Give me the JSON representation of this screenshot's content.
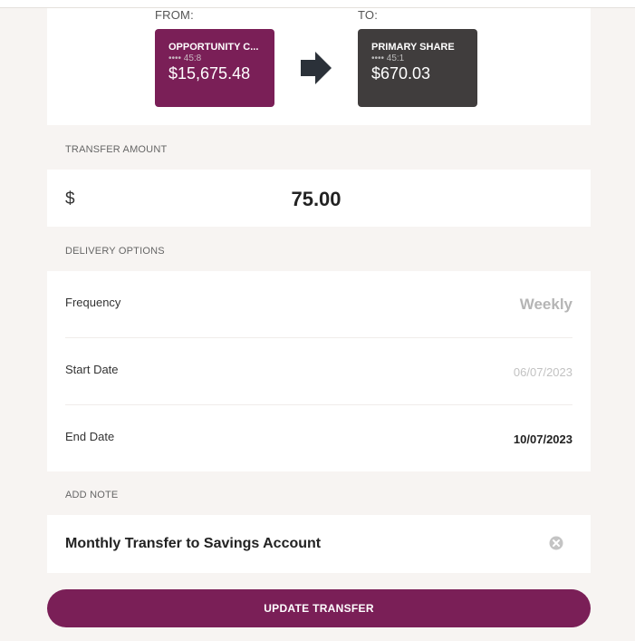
{
  "transfer": {
    "from_label": "FROM:",
    "to_label": "TO:",
    "from_account": {
      "name": "OPPORTUNITY C...",
      "mask": "•••• 45:8",
      "balance": "$15,675.48",
      "color": "#7a1f57"
    },
    "to_account": {
      "name": "PRIMARY SHARE",
      "mask": "•••• 45:1",
      "balance": "$670.03",
      "color": "#403d3d"
    },
    "arrow_icon": "arrow-right-icon"
  },
  "amount": {
    "header": "TRANSFER AMOUNT",
    "currency": "$",
    "value": "75.00"
  },
  "delivery": {
    "header": "DELIVERY OPTIONS",
    "frequency_label": "Frequency",
    "frequency_value": "Weekly",
    "start_label": "Start Date",
    "start_value": "06/07/2023",
    "end_label": "End Date",
    "end_value": "10/07/2023"
  },
  "note": {
    "header": "ADD NOTE",
    "value": "Monthly Transfer to Savings Account",
    "clear_icon": "clear-icon"
  },
  "actions": {
    "update_label": "UPDATE TRANSFER"
  },
  "colors": {
    "accent": "#7a1f57",
    "page_bg": "#f7f4f2"
  }
}
